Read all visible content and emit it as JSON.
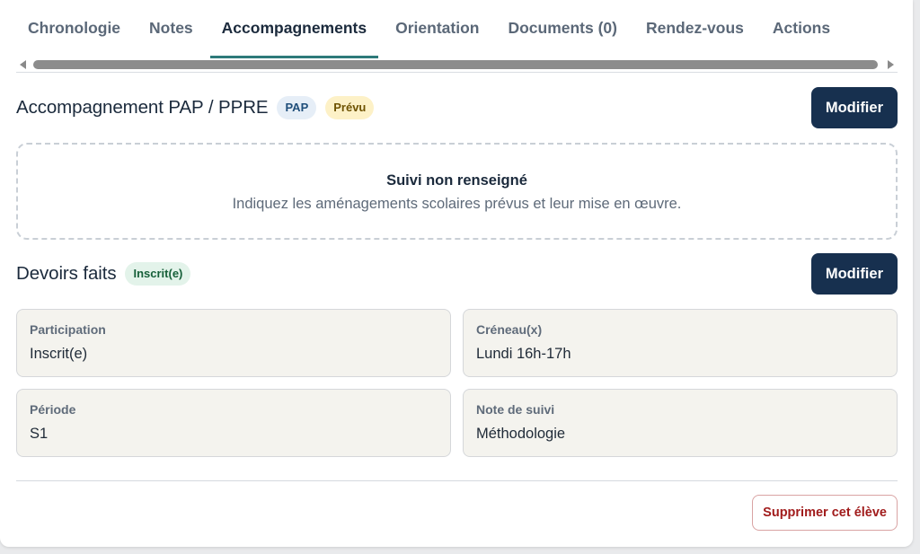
{
  "tabs": [
    {
      "label": "Chronologie",
      "active": false
    },
    {
      "label": "Notes",
      "active": false
    },
    {
      "label": "Accompagnements",
      "active": true
    },
    {
      "label": "Orientation",
      "active": false
    },
    {
      "label": "Documents (0)",
      "active": false
    },
    {
      "label": "Rendez-vous",
      "active": false
    },
    {
      "label": "Actions",
      "active": false
    }
  ],
  "pap": {
    "title": "Accompagnement PAP / PPRE",
    "badge_type": "PAP",
    "badge_status": "Prévu",
    "edit_label": "Modifier",
    "empty_title": "Suivi non renseigné",
    "empty_desc": "Indiquez les aménagements scolaires prévus et leur mise en œuvre."
  },
  "devoirs": {
    "title": "Devoirs faits",
    "badge_status": "Inscrit(e)",
    "edit_label": "Modifier",
    "fields": [
      {
        "label": "Participation",
        "value": "Inscrit(e)"
      },
      {
        "label": "Créneau(x)",
        "value": "Lundi 16h-17h"
      },
      {
        "label": "Période",
        "value": "S1"
      },
      {
        "label": "Note de suivi",
        "value": "Méthodologie"
      }
    ]
  },
  "footer": {
    "delete_label": "Supprimer cet élève"
  },
  "colors": {
    "primary": "#17304f",
    "tab_active_underline": "#2e7a7a",
    "danger": "#a11c1c"
  }
}
